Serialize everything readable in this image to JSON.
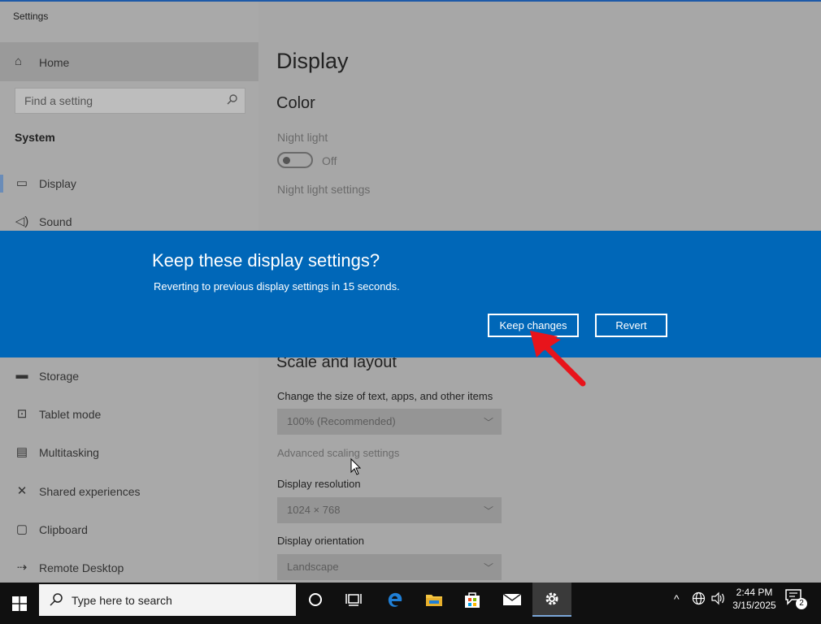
{
  "window": {
    "title": "Settings",
    "minimize_icon": "minimize-icon",
    "maximize_icon": "maximize-icon",
    "close_icon": "close-icon"
  },
  "sidebar": {
    "home_label": "Home",
    "search_placeholder": "Find a setting",
    "section": "System",
    "items": [
      {
        "label": "Display",
        "icon": "monitor-icon"
      },
      {
        "label": "Sound",
        "icon": "speaker-icon"
      },
      {
        "label": "Storage",
        "icon": "storage-icon"
      },
      {
        "label": "Tablet mode",
        "icon": "tablet-icon"
      },
      {
        "label": "Multitasking",
        "icon": "multitasking-icon"
      },
      {
        "label": "Shared experiences",
        "icon": "shared-icon"
      },
      {
        "label": "Clipboard",
        "icon": "clipboard-icon"
      },
      {
        "label": "Remote Desktop",
        "icon": "remote-desktop-icon"
      }
    ]
  },
  "main": {
    "page_title": "Display",
    "color_heading": "Color",
    "night_light_label": "Night light",
    "night_light_state": "Off",
    "night_light_settings": "Night light settings",
    "scale_heading": "Scale and layout",
    "scale_label": "Change the size of text, apps, and other items",
    "scale_value": "100% (Recommended)",
    "advanced_scaling": "Advanced scaling settings",
    "resolution_label": "Display resolution",
    "resolution_value": "1024 × 768",
    "orientation_label": "Display orientation",
    "orientation_value": "Landscape"
  },
  "dialog": {
    "title": "Keep these display settings?",
    "message": "Reverting to previous display settings in 15 seconds.",
    "keep_label": "Keep changes",
    "revert_label": "Revert",
    "accent_color": "#0067b8"
  },
  "annotation": {
    "arrow_color": "#e8141b"
  },
  "taskbar": {
    "search_placeholder": "Type here to search",
    "time": "2:44 PM",
    "date": "3/15/2025",
    "notification_count": "2"
  }
}
